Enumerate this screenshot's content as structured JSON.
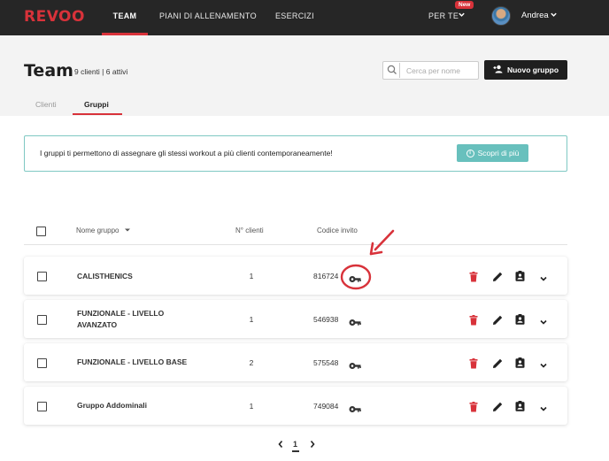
{
  "brand": {
    "logo_text": "REVOO",
    "accent_color": "#d8323a"
  },
  "topnav": {
    "items": [
      {
        "label": "TEAM",
        "active": true
      },
      {
        "label": "PIANI DI ALLENAMENTO",
        "active": false
      },
      {
        "label": "ESERCIZI",
        "active": false
      }
    ],
    "for_you": {
      "label": "PER TE",
      "badge": "New"
    },
    "user": {
      "name": "Andrea"
    }
  },
  "header": {
    "title": "Team",
    "subtitle": "9 clienti | 6 attivi",
    "search": {
      "placeholder": "Cerca per nome",
      "value": ""
    },
    "new_group_button": "Nuovo gruppo"
  },
  "tabs": [
    {
      "label": "Clienti",
      "active": false
    },
    {
      "label": "Gruppi",
      "active": true
    }
  ],
  "info_banner": {
    "text": "I gruppi ti permettono di assegnare gli stessi workout a più clienti contemporaneamente!",
    "button": "Scopri di più",
    "color": "#68c0bd"
  },
  "table": {
    "columns": {
      "name": "Nome gruppo",
      "count": "N° clienti",
      "code": "Codice invito"
    },
    "rows": [
      {
        "name_lines": [
          "CALISTHENICS"
        ],
        "clients": "1",
        "code": "816724",
        "highlighted": true
      },
      {
        "name_lines": [
          "FUNZIONALE - LIVELLO",
          "AVANZATO"
        ],
        "clients": "1",
        "code": "546938",
        "highlighted": false
      },
      {
        "name_lines": [
          "FUNZIONALE - LIVELLO BASE"
        ],
        "clients": "2",
        "code": "575548",
        "highlighted": false
      },
      {
        "name_lines": [
          "Gruppo Addominali"
        ],
        "clients": "1",
        "code": "749084",
        "highlighted": false
      }
    ]
  },
  "pagination": {
    "current": "1",
    "prev_icon": "chevron-left-icon",
    "next_icon": "chevron-right-icon"
  },
  "annotation": {
    "color": "#d8323a",
    "shape": "arrow-and-circle",
    "target": "invite-code-key-icon"
  }
}
